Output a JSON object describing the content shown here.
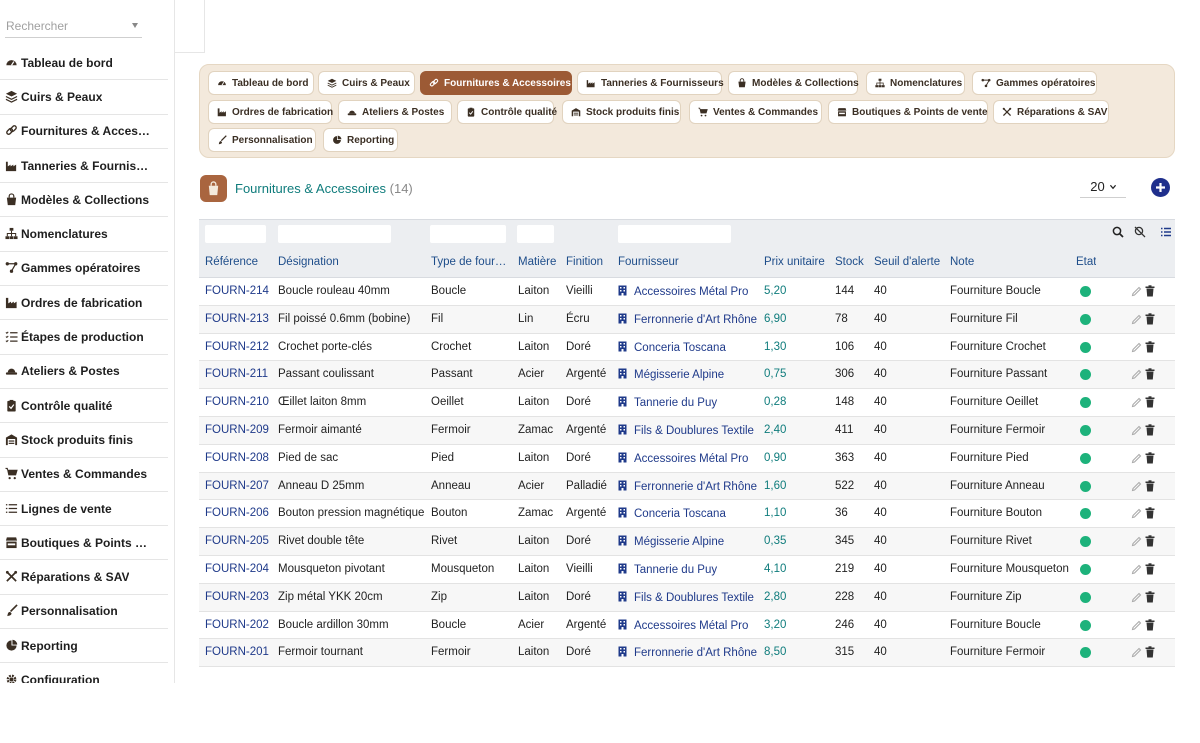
{
  "sidebar": {
    "search_placeholder": "Rechercher",
    "items": [
      {
        "label": "Tableau de bord",
        "icon": "gauge-icon"
      },
      {
        "label": "Cuirs & Peaux",
        "icon": "layers-icon"
      },
      {
        "label": "Fournitures & Acces…",
        "icon": "link-icon"
      },
      {
        "label": "Tanneries & Fournis…",
        "icon": "factory-icon"
      },
      {
        "label": "Modèles & Collections",
        "icon": "bag-icon"
      },
      {
        "label": "Nomenclatures",
        "icon": "sitemap-icon"
      },
      {
        "label": "Gammes opératoires",
        "icon": "route-icon"
      },
      {
        "label": "Ordres de fabrication",
        "icon": "industry-icon"
      },
      {
        "label": "Étapes de production",
        "icon": "list-check-icon"
      },
      {
        "label": "Ateliers & Postes",
        "icon": "hat-icon"
      },
      {
        "label": "Contrôle qualité",
        "icon": "clipboard-check-icon"
      },
      {
        "label": "Stock produits finis",
        "icon": "warehouse-icon"
      },
      {
        "label": "Ventes & Commandes",
        "icon": "cart-icon"
      },
      {
        "label": "Lignes de vente",
        "icon": "list-icon"
      },
      {
        "label": "Boutiques & Points …",
        "icon": "store-icon"
      },
      {
        "label": "Réparations & SAV",
        "icon": "tools-icon"
      },
      {
        "label": "Personnalisation",
        "icon": "brush-icon"
      },
      {
        "label": "Reporting",
        "icon": "pie-icon"
      },
      {
        "label": "Configuration",
        "icon": "gear-icon"
      }
    ]
  },
  "tabs": [
    {
      "label": "Tableau de bord",
      "icon": "gauge-icon"
    },
    {
      "label": "Cuirs & Peaux",
      "icon": "layers-icon"
    },
    {
      "label": "Fournitures & Accessoires",
      "icon": "link-icon",
      "active": true
    },
    {
      "label": "Tanneries & Fournisseurs",
      "icon": "factory-icon"
    },
    {
      "label": "Modèles & Collections",
      "icon": "bag-icon"
    },
    {
      "label": "Nomenclatures",
      "icon": "sitemap-icon"
    },
    {
      "label": "Gammes opératoires",
      "icon": "route-icon"
    },
    {
      "label": "Ordres de fabrication",
      "icon": "industry-icon"
    },
    {
      "label": "Ateliers & Postes",
      "icon": "hat-icon"
    },
    {
      "label": "Contrôle qualité",
      "icon": "clipboard-check-icon"
    },
    {
      "label": "Stock produits finis",
      "icon": "warehouse-icon"
    },
    {
      "label": "Ventes & Commandes",
      "icon": "cart-icon"
    },
    {
      "label": "Boutiques & Points de vente",
      "icon": "store-icon"
    },
    {
      "label": "Réparations & SAV",
      "icon": "tools-icon"
    },
    {
      "label": "Personnalisation",
      "icon": "brush-icon"
    },
    {
      "label": "Reporting",
      "icon": "pie-icon"
    }
  ],
  "section": {
    "title": "Fournitures & Accessoires",
    "count": "(14)",
    "icon": "shopping-bag-icon",
    "page_size": "20"
  },
  "table": {
    "columns": [
      "Référence",
      "Désignation",
      "Type de four…",
      "Matière",
      "Finition",
      "Fournisseur",
      "Prix unitaire",
      "Stock",
      "Seuil d'alerte",
      "Note",
      "État"
    ],
    "rows": [
      [
        "FOURN-214",
        "Boucle rouleau 40mm",
        "Boucle",
        "Laiton",
        "Vieilli",
        "Accessoires Métal Pro",
        "5,20",
        "144",
        "40",
        "Fourniture Boucle"
      ],
      [
        "FOURN-213",
        "Fil poissé 0.6mm (bobine)",
        "Fil",
        "Lin",
        "Écru",
        "Ferronnerie d'Art Rhône",
        "6,90",
        "78",
        "40",
        "Fourniture Fil"
      ],
      [
        "FOURN-212",
        "Crochet porte-clés",
        "Crochet",
        "Laiton",
        "Doré",
        "Conceria Toscana",
        "1,30",
        "106",
        "40",
        "Fourniture Crochet"
      ],
      [
        "FOURN-211",
        "Passant coulissant",
        "Passant",
        "Acier",
        "Argenté",
        "Mégisserie Alpine",
        "0,75",
        "306",
        "40",
        "Fourniture Passant"
      ],
      [
        "FOURN-210",
        "Œillet laiton 8mm",
        "Oeillet",
        "Laiton",
        "Doré",
        "Tannerie du Puy",
        "0,28",
        "148",
        "40",
        "Fourniture Oeillet"
      ],
      [
        "FOURN-209",
        "Fermoir aimanté",
        "Fermoir",
        "Zamac",
        "Argenté",
        "Fils & Doublures Textile",
        "2,40",
        "411",
        "40",
        "Fourniture Fermoir"
      ],
      [
        "FOURN-208",
        "Pied de sac",
        "Pied",
        "Laiton",
        "Doré",
        "Accessoires Métal Pro",
        "0,90",
        "363",
        "40",
        "Fourniture Pied"
      ],
      [
        "FOURN-207",
        "Anneau D 25mm",
        "Anneau",
        "Acier",
        "Palladié",
        "Ferronnerie d'Art Rhône",
        "1,60",
        "522",
        "40",
        "Fourniture Anneau"
      ],
      [
        "FOURN-206",
        "Bouton pression magnétique",
        "Bouton",
        "Zamac",
        "Argenté",
        "Conceria Toscana",
        "1,10",
        "36",
        "40",
        "Fourniture Bouton"
      ],
      [
        "FOURN-205",
        "Rivet double tête",
        "Rivet",
        "Laiton",
        "Doré",
        "Mégisserie Alpine",
        "0,35",
        "345",
        "40",
        "Fourniture Rivet"
      ],
      [
        "FOURN-204",
        "Mousqueton pivotant",
        "Mousqueton",
        "Laiton",
        "Vieilli",
        "Tannerie du Puy",
        "4,10",
        "219",
        "40",
        "Fourniture Mousqueton"
      ],
      [
        "FOURN-203",
        "Zip métal YKK 20cm",
        "Zip",
        "Laiton",
        "Doré",
        "Fils & Doublures Textile",
        "2,80",
        "228",
        "40",
        "Fourniture Zip"
      ],
      [
        "FOURN-202",
        "Boucle ardillon 30mm",
        "Boucle",
        "Acier",
        "Argenté",
        "Accessoires Métal Pro",
        "3,20",
        "246",
        "40",
        "Fourniture Boucle"
      ],
      [
        "FOURN-201",
        "Fermoir tournant",
        "Fermoir",
        "Laiton",
        "Doré",
        "Ferronnerie d'Art Rhône",
        "8,50",
        "315",
        "40",
        "Fourniture Fermoir"
      ]
    ]
  },
  "colors": {
    "accent_brown": "#9c5a35",
    "tabs_bg": "#f3e9dc",
    "link_blue": "#1f3a8a",
    "price_teal": "#0f7c7c",
    "state_green": "#1db27b",
    "add_button": "#1f2f8c"
  }
}
